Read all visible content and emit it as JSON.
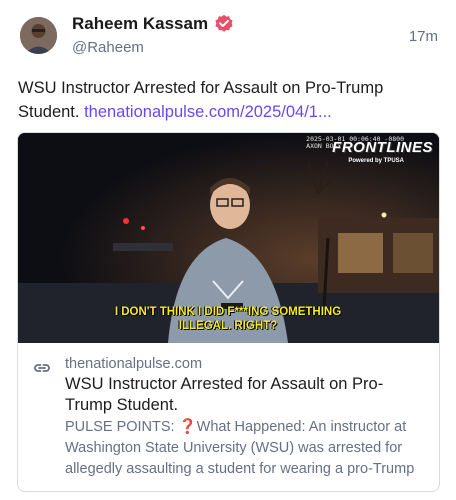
{
  "author": {
    "name": "Raheem Kassam",
    "handle": "@Raheem",
    "time": "17m"
  },
  "post": {
    "text": "WSU Instructor Arrested for Assault on Pro-Trump Student. ",
    "link": "thenationalpulse.com/2025/04/1..."
  },
  "card": {
    "media": {
      "timestamp_line1": "2025-03-01 00:06:40 -0800",
      "timestamp_line2": "AXON BODY",
      "brand": "FRONTLINES",
      "powered_by": "Powered by TPUSA",
      "caption": "I DON'T THINK I DID F***ING SOMETHING ILLEGAL. RIGHT?"
    },
    "domain": "thenationalpulse.com",
    "title": "WSU Instructor Arrested for Assault on Pro-Trump Student.",
    "description": "PULSE POINTS: ❓What Happened: An instructor at Washington State University (WSU) was arrested for allegedly assaulting a student for wearing a pro-Trump"
  },
  "colors": {
    "link": "#6a48f0",
    "verified": "#e8506a",
    "caption": "#f6ea2a"
  }
}
